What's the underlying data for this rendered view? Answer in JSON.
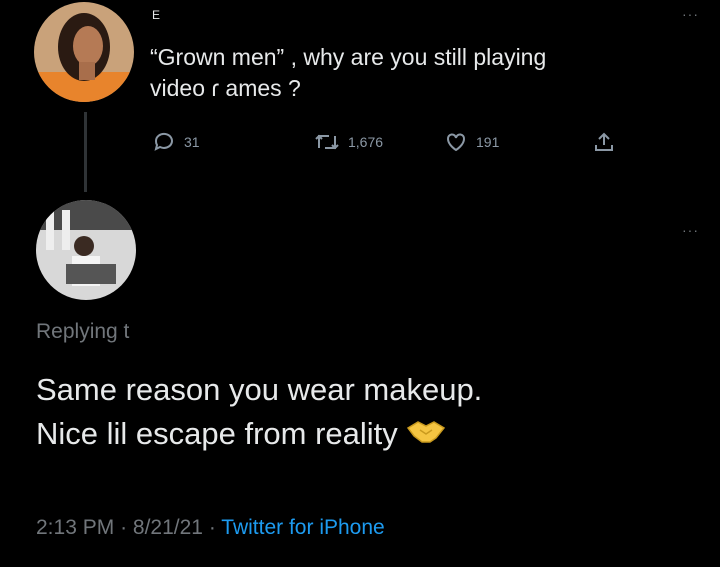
{
  "original_tweet": {
    "name_fragment": "E",
    "text_line1": "“Grown men” , why are you still playing",
    "text_line2": "video ɾ ames ?",
    "stats": {
      "replies": "31",
      "retweets": "1,676",
      "likes": "191"
    },
    "icons": [
      "reply-icon",
      "retweet-icon",
      "like-icon",
      "share-icon"
    ]
  },
  "reply_tweet": {
    "replying_to": "Replying t",
    "text_line1": "Same reason you wear makeup.",
    "text_line2": "Nice lil escape from reality",
    "emoji": "handshake-icon",
    "time": "2:13 PM",
    "separator": "·",
    "date": "8/21/21",
    "source": "Twitter for iPhone"
  },
  "more_icon": "···",
  "colors": {
    "background": "#000000",
    "text": "#e7e9ea",
    "muted": "#71767b",
    "link": "#1d9bf0",
    "handshake": "#f5c542"
  }
}
